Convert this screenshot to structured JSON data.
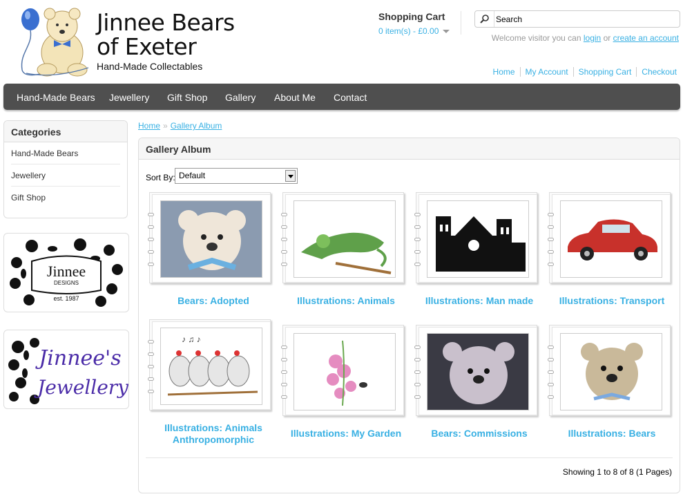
{
  "logo": {
    "line1": "Jinnee Bears",
    "line2": "of Exeter",
    "tagline": "Hand-Made Collectables"
  },
  "cart": {
    "title": "Shopping Cart",
    "items": "0 item(s) - £0.00"
  },
  "search": {
    "placeholder": "Search",
    "value": "Search"
  },
  "welcome": {
    "prefix": "Welcome visitor you can",
    "login": "login",
    "or": "or",
    "create": "create an account"
  },
  "toplinks": [
    "Home",
    "My Account",
    "Shopping Cart",
    "Checkout"
  ],
  "nav": [
    "Hand-Made Bears",
    "Jewellery",
    "Gift Shop",
    "Gallery",
    "About Me",
    "Contact"
  ],
  "categories": {
    "title": "Categories",
    "items": [
      "Hand-Made Bears",
      "Jewellery",
      "Gift Shop"
    ]
  },
  "banners": {
    "designs": {
      "name": "Jinnee",
      "sub": "DESIGNS",
      "est": "est. 1987"
    },
    "jewellery": {
      "line1": "Jinnee's",
      "line2": "Jewellery"
    }
  },
  "breadcrumb": {
    "home": "Home",
    "sep": "»",
    "current": "Gallery Album"
  },
  "main": {
    "title": "Gallery Album",
    "sort_label": "Sort By:",
    "sort_value": "Default"
  },
  "albums": [
    {
      "title": "Bears: Adopted"
    },
    {
      "title": "Illustrations: Animals"
    },
    {
      "title": "Illustrations: Man made"
    },
    {
      "title": "Illustrations: Transport"
    },
    {
      "title": "Illustrations: Animals Anthropomorphic"
    },
    {
      "title": "Illustrations: My Garden"
    },
    {
      "title": "Bears: Commissions"
    },
    {
      "title": "Illustrations: Bears"
    }
  ],
  "pagination": "Showing 1 to 8 of 8 (1 Pages)",
  "colors": {
    "link": "#38b0e3",
    "nav": "#4f4f4f"
  }
}
